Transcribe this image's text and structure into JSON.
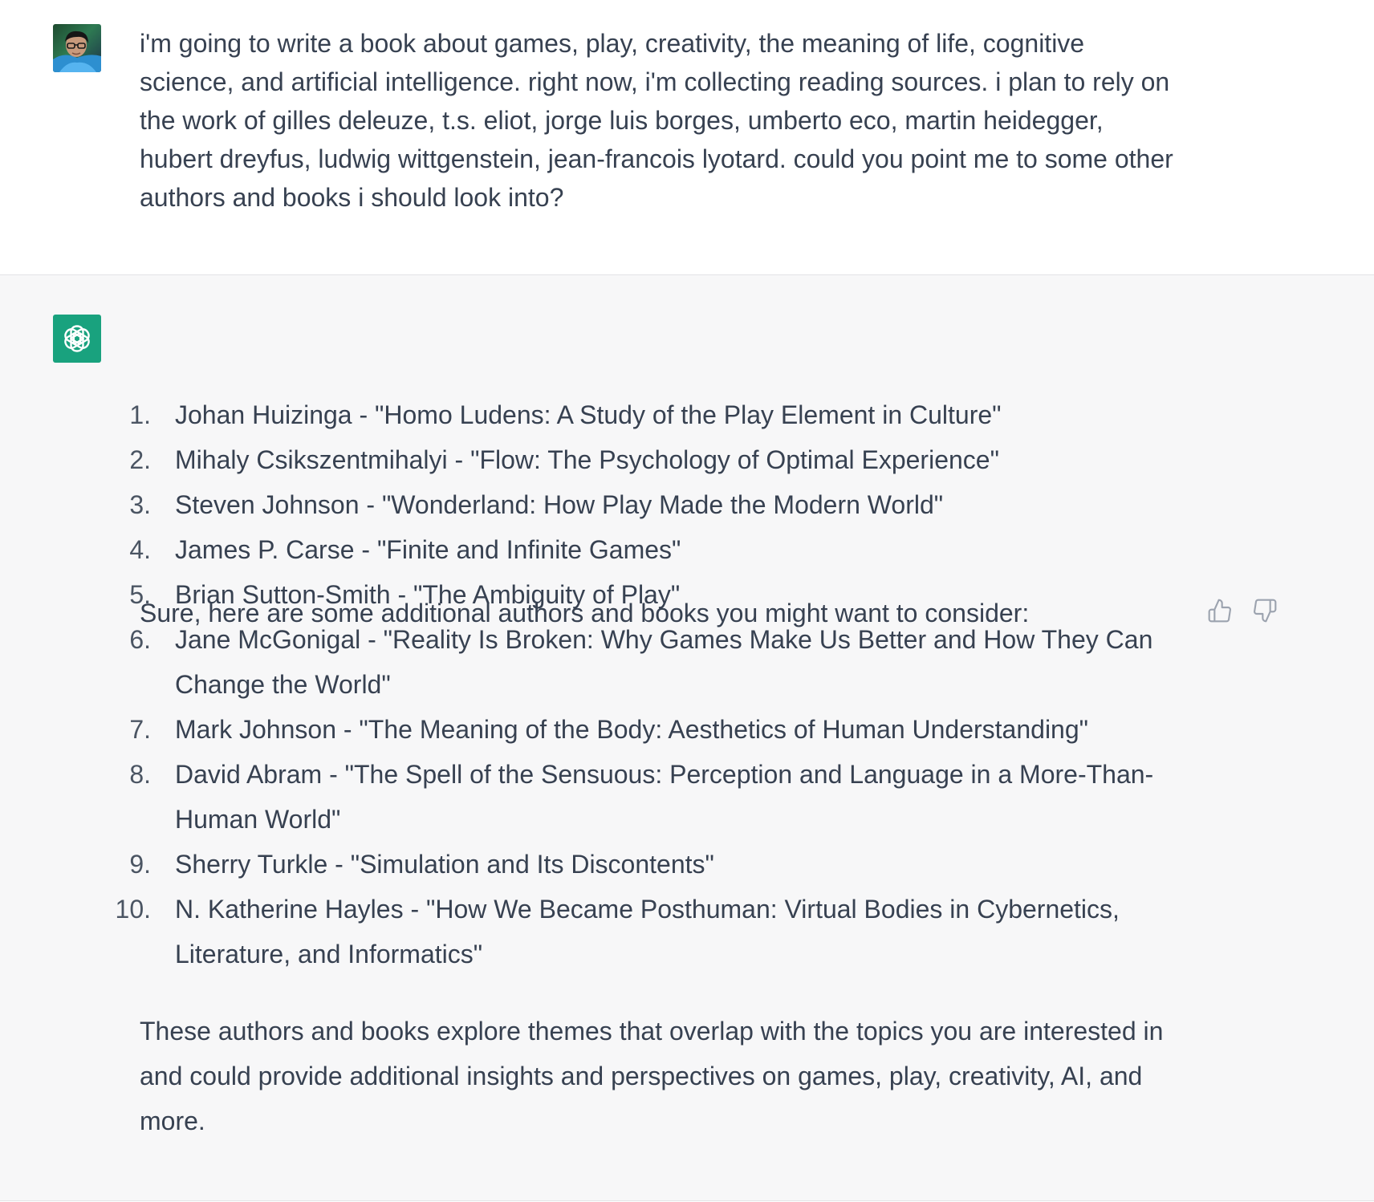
{
  "user": {
    "message": "i'm going to write a book about games, play, creativity, the meaning of life, cognitive science, and artificial intelligence. right now, i'm collecting reading sources. i plan to rely on the work of gilles deleuze, t.s. eliot, jorge luis borges, umberto eco, martin heidegger, hubert dreyfus, ludwig wittgenstein, jean-francois lyotard. could you point me to some other authors and books i should look into?",
    "avatar_icon": "user-avatar-photo"
  },
  "assistant": {
    "avatar_icon": "openai-logo-icon",
    "intro": "Sure, here are some additional authors and books you might want to consider:",
    "items": [
      {
        "num": "1.",
        "text": "Johan Huizinga - \"Homo Ludens: A Study of the Play Element in Culture\""
      },
      {
        "num": "2.",
        "text": "Mihaly Csikszentmihalyi - \"Flow: The Psychology of Optimal Experience\""
      },
      {
        "num": "3.",
        "text": "Steven Johnson - \"Wonderland: How Play Made the Modern World\""
      },
      {
        "num": "4.",
        "text": "James P. Carse - \"Finite and Infinite Games\""
      },
      {
        "num": "5.",
        "text": "Brian Sutton-Smith - \"The Ambiguity of Play\""
      },
      {
        "num": "6.",
        "text": "Jane McGonigal - \"Reality Is Broken: Why Games Make Us Better and How They Can Change the World\""
      },
      {
        "num": "7.",
        "text": "Mark Johnson - \"The Meaning of the Body: Aesthetics of Human Understanding\""
      },
      {
        "num": "8.",
        "text": "David Abram - \"The Spell of the Sensuous: Perception and Language in a More-Than-Human World\""
      },
      {
        "num": "9.",
        "text": "Sherry Turkle - \"Simulation and Its Discontents\""
      },
      {
        "num": "10.",
        "text": "N. Katherine Hayles - \"How We Became Posthuman: Virtual Bodies in Cybernetics, Literature, and Informatics\""
      }
    ],
    "outro": "These authors and books explore themes that overlap with the topics you are interested in and could provide additional insights and perspectives on games, play, creativity, AI, and more.",
    "feedback": {
      "thumbs_up_icon": "thumbs-up-icon",
      "thumbs_down_icon": "thumbs-down-icon"
    }
  },
  "colors": {
    "assistant_background": "#f7f7f8",
    "user_background": "#ffffff",
    "text": "#374151",
    "assistant_avatar": "#19a27e"
  }
}
